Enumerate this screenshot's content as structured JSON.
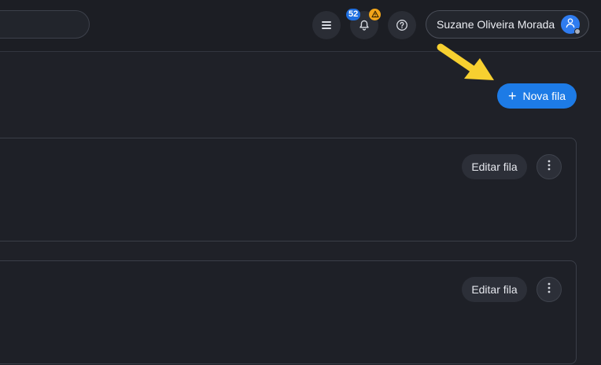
{
  "header": {
    "notification_count": "52",
    "user_name": "Suzane Oliveira Morada",
    "icons": [
      "menu-icon",
      "bell-icon",
      "warning-icon",
      "help-icon",
      "user-icon"
    ]
  },
  "page": {
    "new_queue_button": "Nova fila"
  },
  "queues": [
    {
      "edit_label": "Editar fila"
    },
    {
      "edit_label": "Editar fila"
    }
  ],
  "colors": {
    "accent": "#1d7be6",
    "badge": "#1f6fe0",
    "warning": "#f2a51a",
    "annotation_arrow": "#f7d030"
  }
}
